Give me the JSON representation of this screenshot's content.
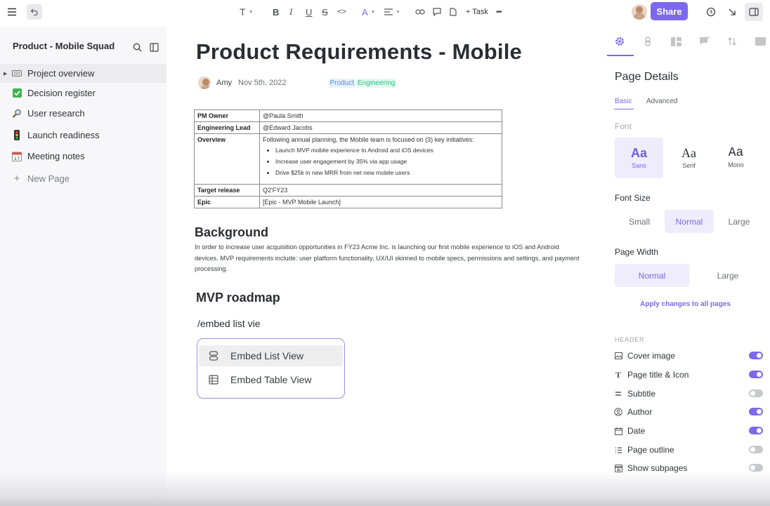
{
  "toolbar": {
    "text_style": "T",
    "bold": "B",
    "italic": "I",
    "underline": "U",
    "strike": "S",
    "code": "<>",
    "font_color": "A",
    "task_label": "+ Task",
    "more": "•••",
    "share_label": "Share"
  },
  "sidebar": {
    "title": "Product - Mobile Squad",
    "items": [
      {
        "label": "Project overview",
        "icon": "keyboard-icon"
      },
      {
        "label": "Decision register",
        "icon": "check-box-icon"
      },
      {
        "label": "User research",
        "icon": "magnifier-icon"
      },
      {
        "label": "Launch readiness",
        "icon": "traffic-light-icon"
      },
      {
        "label": "Meeting notes",
        "icon": "calendar-icon"
      }
    ],
    "new_page": "New Page"
  },
  "doc": {
    "title": "Product Requirements - Mobile",
    "author": "Amy",
    "date": "Nov 5th, 2022",
    "tags": [
      {
        "label": "Product",
        "color": "#4a90e2",
        "bg": "#e8f1fc"
      },
      {
        "label": "Engineering",
        "color": "#2ec28b",
        "bg": "#e6f8f0"
      }
    ],
    "table": {
      "pm_owner_key": "PM Owner",
      "pm_owner_val": "@Paula Smith",
      "eng_lead_key": "Engineering Lead",
      "eng_lead_val": "@Edward Jacobs",
      "overview_key": "Overview",
      "overview_intro": "Following annual planning, the Mobile team is focused on (3) key initiatives:",
      "overview_bullets": [
        "Launch MVP mobile experience to Android and iOS devices",
        "Increase user engagement by 35% via app usage",
        "Drive $25k in new MRR from net new mobile users"
      ],
      "target_key": "Target release",
      "target_val": "Q2'FY23",
      "epic_key": "Epic",
      "epic_val": "[Epic - MVP Mobile Launch]"
    },
    "background_heading": "Background",
    "background_text": "In order to increase user acquisition opportunities in FY23 Acme Inc. is launching our first mobile experience to iOS and Android devices. MVP requirements include: user platform functionality, UX/UI skinned to mobile specs, permissions and settings, and payment processing.",
    "roadmap_heading": "MVP roadmap",
    "embed_command": "/embed list vie",
    "embed_options": [
      "Embed List View",
      "Embed Table View"
    ]
  },
  "panel": {
    "title": "Page Details",
    "tab_basic": "Basic",
    "tab_advanced": "Advanced",
    "font_label": "Font",
    "fonts": [
      {
        "sample": "Aa",
        "name": "Sans"
      },
      {
        "sample": "Aa",
        "name": "Serif"
      },
      {
        "sample": "Aa",
        "name": "Mono"
      }
    ],
    "font_size_label": "Font Size",
    "font_sizes": [
      "Small",
      "Normal",
      "Large"
    ],
    "page_width_label": "Page Width",
    "page_widths": [
      "Normal",
      "Large"
    ],
    "apply_all": "Apply changes to all pages",
    "header_label": "HEADER",
    "toggles": [
      {
        "label": "Cover image",
        "icon": "image-icon",
        "on": true
      },
      {
        "label": "Page title & Icon",
        "icon": "title-icon",
        "on": true
      },
      {
        "label": "Subtitle",
        "icon": "subtitle-icon",
        "on": false
      },
      {
        "label": "Author",
        "icon": "user-circle-icon",
        "on": true
      },
      {
        "label": "Date",
        "icon": "calendar-icon",
        "on": true
      },
      {
        "label": "Page outline",
        "icon": "list-icon",
        "on": false
      },
      {
        "label": "Show subpages",
        "icon": "subpages-icon",
        "on": false
      }
    ]
  },
  "colors": {
    "accent": "#7b68ee",
    "accent_light": "#efedfc"
  }
}
